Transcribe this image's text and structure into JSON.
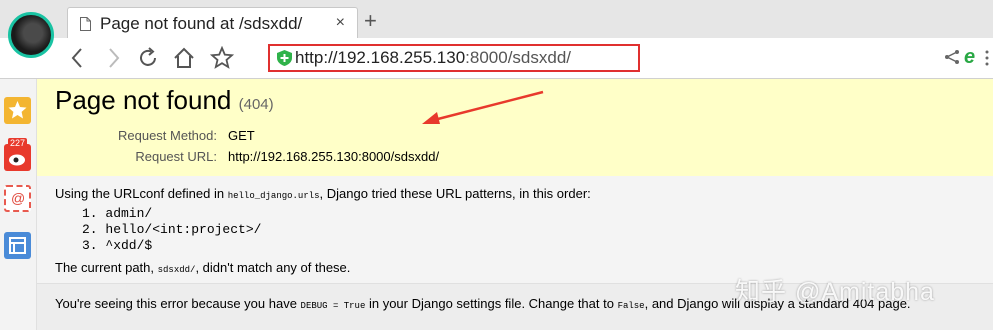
{
  "browser": {
    "tab": {
      "title": "Page not found at /sdsxdd/",
      "close": "×"
    },
    "new_tab": "+",
    "url": {
      "host": "http://192.168.255.130",
      "rest": ":8000/sdsxdd/"
    },
    "icons": [
      "back-icon",
      "forward-icon",
      "reload-icon",
      "home-icon",
      "star-icon",
      "shield-icon",
      "share-icon",
      "ie-icon",
      "menu-icon"
    ],
    "accent": "#e0302f"
  },
  "sidebar": {
    "items": [
      "favorites-star-icon",
      "weibo-icon",
      "mail-icon",
      "notes-icon"
    ],
    "weibo_badge": "227"
  },
  "page": {
    "title": "Page not found",
    "status_code": "(404)",
    "request_method_label": "Request Method:",
    "request_method": "GET",
    "request_url_label": "Request URL:",
    "request_url": "http://192.168.255.130:8000/sdsxdd/",
    "urlconf_prefix": "Using the URLconf defined in ",
    "urlconf_module": "hello_django.urls",
    "urlconf_suffix": ", Django tried these URL patterns, in this order:",
    "patterns": [
      "1.  admin/",
      "2.  hello/<int:project>/",
      "3.  ^xdd/$"
    ],
    "current_path_prefix": "The current path, ",
    "current_path": "sdsxdd/",
    "current_path_suffix": ", didn't match any of these.",
    "debug_prefix": "You're seeing this error because you have ",
    "debug_setting": "DEBUG = True",
    "debug_middle": " in your Django settings file. Change that to ",
    "debug_false": "False",
    "debug_suffix": ", and Django will display a standard 404 page."
  },
  "colors": {
    "summary_bg": "#ffffc8",
    "info_bg": "#f4f4f4"
  },
  "watermark": "知乎 @Amitabha"
}
